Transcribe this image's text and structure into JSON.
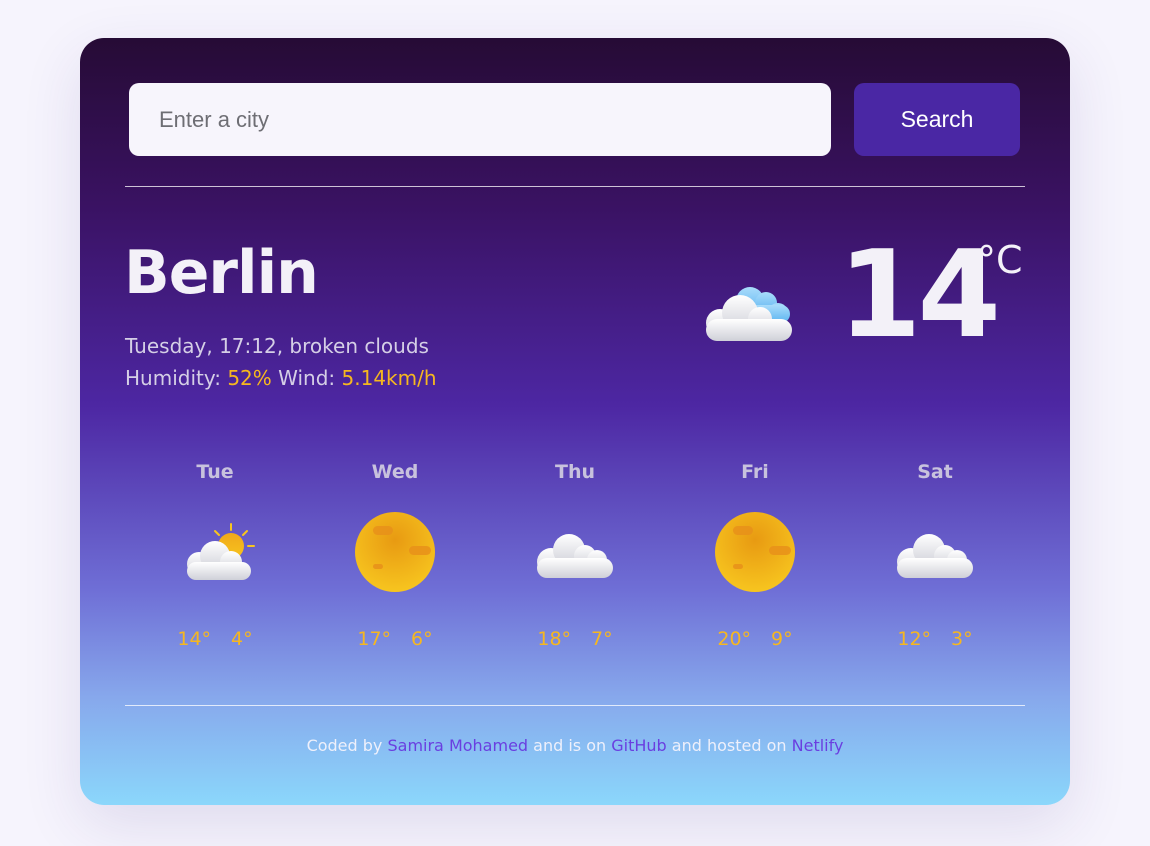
{
  "search": {
    "placeholder": "Enter a city",
    "button_label": "Search"
  },
  "current": {
    "city": "Berlin",
    "description_line": "Tuesday, 17:12, broken clouds",
    "humidity_label": "Humidity:",
    "humidity_value": "52%",
    "wind_label": "Wind:",
    "wind_value": "5.14km/h",
    "temperature": "14",
    "unit": "°C",
    "icon": "broken-clouds-icon"
  },
  "forecast": [
    {
      "day": "Tue",
      "icon": "partly-cloudy-icon",
      "max": "14°",
      "min": "4°"
    },
    {
      "day": "Wed",
      "icon": "sun-icon",
      "max": "17°",
      "min": "6°"
    },
    {
      "day": "Thu",
      "icon": "cloud-icon",
      "max": "18°",
      "min": "7°"
    },
    {
      "day": "Fri",
      "icon": "sun-icon",
      "max": "20°",
      "min": "9°"
    },
    {
      "day": "Sat",
      "icon": "cloud-icon",
      "max": "12°",
      "min": "3°"
    }
  ],
  "footer": {
    "coded_by": "Coded by",
    "author": "Samira Mohamed",
    "mid_text": "and is on",
    "github": "GitHub",
    "hosted_text": "and hosted on",
    "netlify": "Netlify"
  },
  "colors": {
    "accent": "#f6b71f",
    "button": "#4a27a4",
    "link": "#6a3fe0"
  }
}
